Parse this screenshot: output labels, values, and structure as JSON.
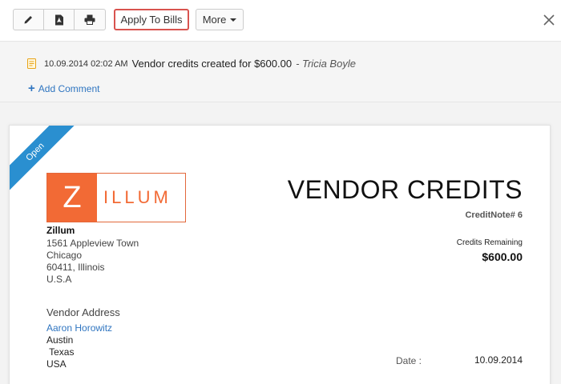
{
  "toolbar": {
    "edit_icon": "pencil-icon",
    "pdf_icon": "pdf-icon",
    "print_icon": "printer-icon",
    "apply_label": "Apply To Bills",
    "more_label": "More",
    "close_icon": "close-icon"
  },
  "history": {
    "time": "10.09.2014 02:02 AM",
    "message": "Vendor credits created for $600.00",
    "author": "- Tricia Boyle",
    "add_comment": "Add Comment"
  },
  "document": {
    "status": "Open",
    "logo": {
      "first": "Z",
      "rest": "ILLUM"
    },
    "org_name": "Zillum",
    "org_address": [
      "1561 Appleview Town",
      "Chicago",
      "60411, Illinois",
      "U.S.A"
    ],
    "title": "VENDOR CREDITS",
    "credit_note": "CreditNote# 6",
    "remaining_label": "Credits Remaining",
    "remaining_value": "$600.00",
    "vendor_label": "Vendor Address",
    "vendor_name": "Aaron Horowitz",
    "vendor_address": [
      "Austin",
      " Texas",
      "USA"
    ],
    "date_label": "Date :",
    "date_value": "10.09.2014"
  },
  "colors": {
    "accent": "#2f75c0",
    "brand": "#f26a35",
    "highlight": "#d9534f",
    "ribbon": "#2a8fd0"
  }
}
